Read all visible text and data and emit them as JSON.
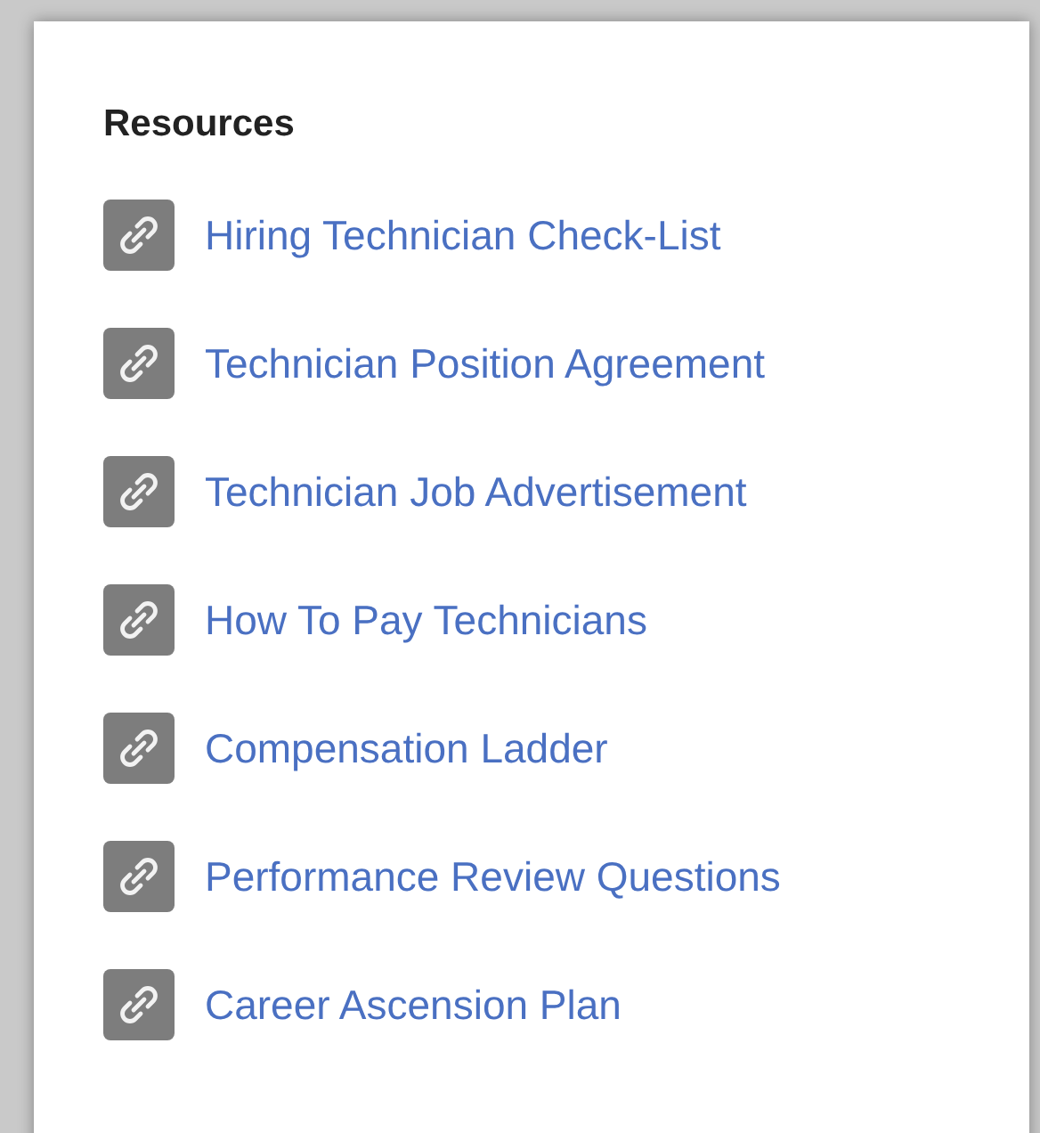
{
  "title": "Resources",
  "links": [
    {
      "label": "Hiring Technician Check-List"
    },
    {
      "label": "Technician Position Agreement"
    },
    {
      "label": "Technician Job Advertisement"
    },
    {
      "label": "How To Pay Technicians"
    },
    {
      "label": "Compensation Ladder"
    },
    {
      "label": "Performance Review Questions"
    },
    {
      "label": "Career Ascension Plan"
    }
  ]
}
